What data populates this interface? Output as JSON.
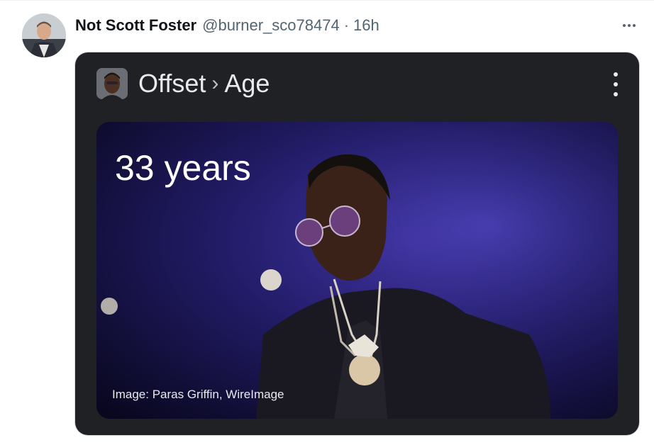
{
  "tweet": {
    "display_name": "Not Scott Foster",
    "handle": "@burner_sco78474",
    "separator": "·",
    "time": "16h",
    "more_icon": "more-horizontal-icon",
    "avatar_icon": "user-avatar"
  },
  "card": {
    "entity": "Offset",
    "breadcrumb_sep": "›",
    "attribute": "Age",
    "kebab_icon": "more-vertical-icon",
    "answer": "33 years",
    "image_credit": "Image: Paras Griffin, WireImage"
  },
  "colors": {
    "text_primary": "#0f1419",
    "text_secondary": "#536471",
    "card_bg": "#202124",
    "card_text": "#e8eaed",
    "photo_bg": "#231d6b"
  }
}
